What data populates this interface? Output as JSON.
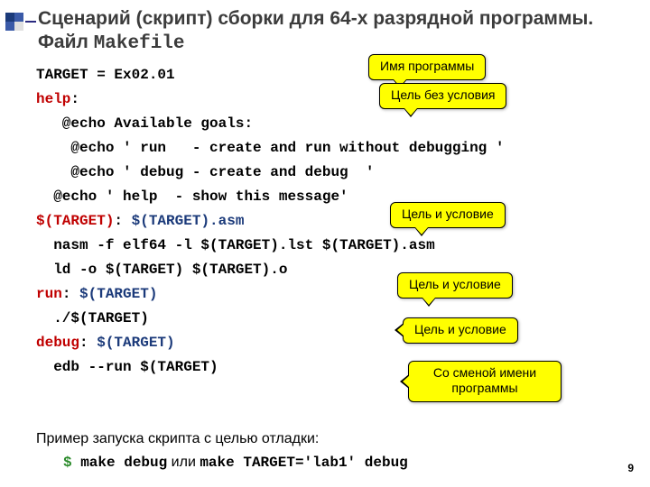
{
  "title": {
    "part1": "Сценарий (скрипт) сборки для 64-х разрядной программы. Файл ",
    "mono": "Makefile"
  },
  "code": {
    "l1_a": "TARGET = Ex02.01",
    "l2_a": "help",
    "l2_b": ":",
    "l3_a": "   @echo Available goals:",
    "l4_a": "    @echo ' run   - create and run without debugging '",
    "l5_a": "    @echo ' debug - create and debug  '",
    "l6_a": "  @echo ' help  - show this message'",
    "l7_a": "$(TARGET)",
    "l7_b": ": ",
    "l7_c": "$(TARGET).asm",
    "l8_a": "  nasm -f elf64 -l $(TARGET).lst $(TARGET).asm",
    "l9_a": "  ld -o $(TARGET) $(TARGET).o",
    "l10_a": "run",
    "l10_b": ": ",
    "l10_c": "$(TARGET)",
    "l11_a": "  ./$(TARGET)",
    "l12_a": "debug",
    "l12_b": ": ",
    "l12_c": "$(TARGET)",
    "l13_a": "  edb --run $(TARGET)"
  },
  "caption": "Пример запуска скрипта с целью отладки:",
  "cmd": {
    "dollar": "$ ",
    "a": "make debug",
    "or": " или ",
    "b": "make TARGET='lab1' debug"
  },
  "callouts": {
    "c1": "Имя программы",
    "c2": "Цель без условия",
    "c3": "Цель и условие",
    "c4": "Цель и условие",
    "c5": "Цель и условие",
    "c6": "Со сменой имени программы"
  },
  "page": "9"
}
